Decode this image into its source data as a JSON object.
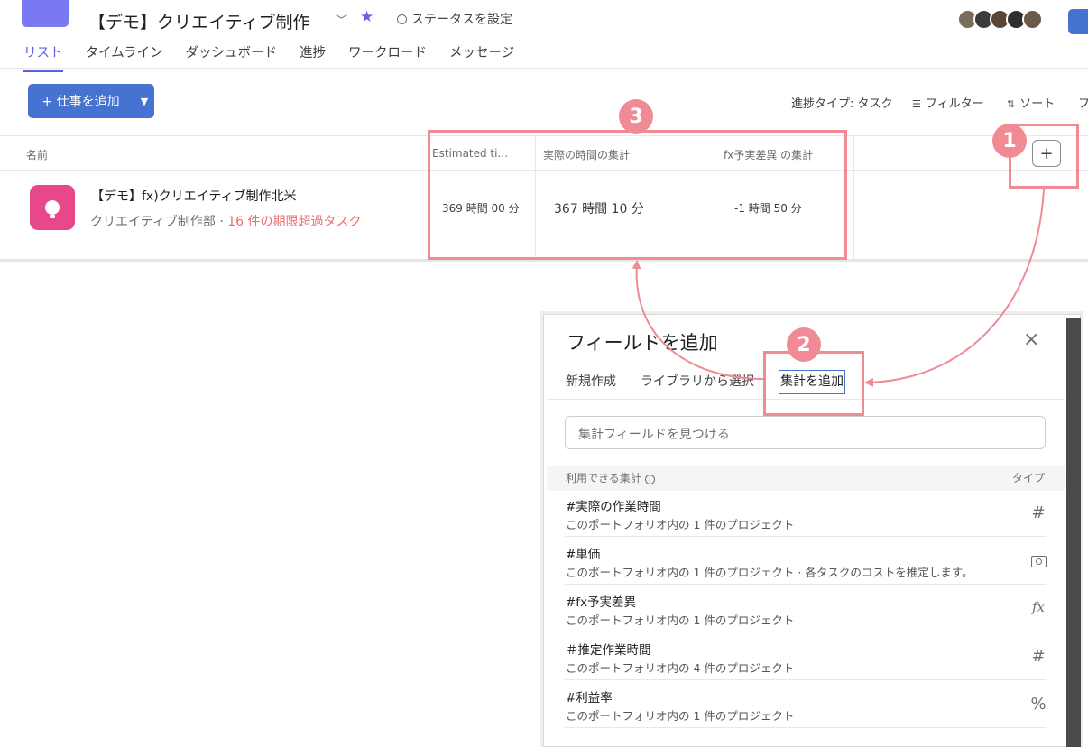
{
  "project": {
    "title": "【デモ】クリエイティブ制作",
    "status_label": "ステータスを設定"
  },
  "tabs": [
    "リスト",
    "タイムライン",
    "ダッシュボード",
    "進捗",
    "ワークロード",
    "メッセージ"
  ],
  "toolbar": {
    "add_task_label": "+ 仕事を追加",
    "progress_type": "進捗タイプ: タスク",
    "filter": "フィルター",
    "sort": "ソート",
    "overflow": "フ"
  },
  "table": {
    "columns": [
      "名前",
      "Estimated ti...",
      "実際の時間の集計",
      "fx予実差異 の集計"
    ],
    "rows": [
      {
        "name": "【デモ】fx)クリエイティブ制作北米",
        "team": "クリエイティブ制作部 · ",
        "overdue": "16 件の期限超過タスク",
        "estimated": "369 時間 00 分",
        "actual": "367 時間 10 分",
        "variance": "-1 時間 50 分"
      }
    ],
    "add_column": "+"
  },
  "annotations": {
    "badge1": "1",
    "badge2": "2",
    "badge3": "3"
  },
  "dialog": {
    "title": "フィールドを追加",
    "close": "×",
    "tabs": [
      "新規作成",
      "ライブラリから選択",
      "集計を追加"
    ],
    "search_placeholder": "集計フィールドを見つける",
    "list_header_left": "利用できる集計",
    "list_header_right": "タイプ",
    "items": [
      {
        "name": "#実際の作業時間",
        "desc": "このポートフォリオ内の 1 件のプロジェクト",
        "type_icon": "hash-icon",
        "type": "#"
      },
      {
        "name": "#単価",
        "desc": "このポートフォリオ内の 1 件のプロジェクト · 各タスクのコストを推定します。",
        "type_icon": "currency-icon",
        "type": ""
      },
      {
        "name": "#fx予実差異",
        "desc": "このポートフォリオ内の 1 件のプロジェクト",
        "type_icon": "formula-icon",
        "type": "fx"
      },
      {
        "name": "＃推定作業時間",
        "desc": "このポートフォリオ内の 4 件のプロジェクト",
        "type_icon": "hash-icon",
        "type": "#"
      },
      {
        "name": "#利益率",
        "desc": "このポートフォリオ内の 1 件のプロジェクト",
        "type_icon": "percent-icon",
        "type": "%"
      }
    ]
  },
  "colors": {
    "accent": "#4573d2",
    "tab_active": "#5b60e0",
    "annotation": "#f08a95",
    "overdue": "#f06a6a",
    "project_icon": "#e8488a"
  }
}
